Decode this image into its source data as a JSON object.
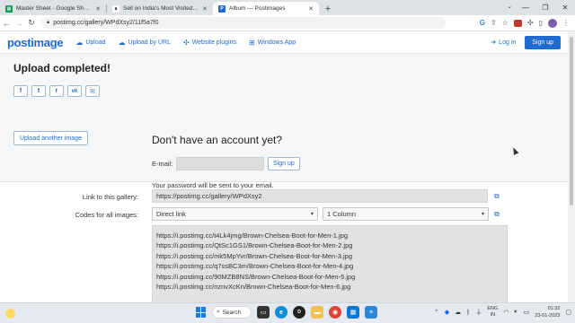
{
  "browser": {
    "tabs": [
      {
        "title": "Master Sheet - Google Sheets",
        "favicon_color": "#0f9d58",
        "favicon_glyph": "▦"
      },
      {
        "title": "Sell on India's Most Visited Shopp",
        "favicon_color": "#111111",
        "favicon_glyph": "a"
      },
      {
        "title": "Album — Postimages",
        "favicon_color": "#1d6bd1",
        "favicon_glyph": "P"
      }
    ],
    "active_tab": 2,
    "url": "postimg.cc/gallery/WPdXsy2/11f5a7f0"
  },
  "site": {
    "logo": "postimage",
    "nav": [
      {
        "label": "Upload",
        "icon": "cloud-upload-icon",
        "glyph": "☁"
      },
      {
        "label": "Upload by URL",
        "icon": "cloud-link-icon",
        "glyph": "☁"
      },
      {
        "label": "Website plugins",
        "icon": "puzzle-icon",
        "glyph": "✣"
      },
      {
        "label": "Windows App",
        "icon": "windows-icon",
        "glyph": "⊞"
      }
    ],
    "login_label": "Log in",
    "signup_label": "Sign up"
  },
  "upload": {
    "title": "Upload completed!",
    "share_buttons": [
      {
        "icon": "facebook-icon",
        "glyph": "f"
      },
      {
        "icon": "twitter-icon",
        "glyph": "t"
      },
      {
        "icon": "reddit-icon",
        "glyph": "r"
      },
      {
        "icon": "vk-icon",
        "glyph": "vk"
      },
      {
        "icon": "mail-icon",
        "glyph": "✉"
      }
    ],
    "upload_another_label": "Upload another image"
  },
  "account": {
    "title": "Don't have an account yet?",
    "email_label": "E-mail:",
    "email_value": "",
    "signup_label": "Sign up",
    "password_note": "Your password will be sent to your email."
  },
  "links": {
    "gallery_label": "Link to this gallery:",
    "gallery_url": "https://postimg.cc/gallery/WPdXsy2",
    "codes_label": "Codes for all images:",
    "link_type": "Direct link",
    "columns": "1 Column",
    "codes": [
      "https://i.postimg.cc/t4Lk4jmg/Brown-Chelsea-Boot-for-Men-1.jpg",
      "https://i.postimg.cc/QtSc1GS1/Brown-Chelsea-Boot-for-Men-2.jpg",
      "https://i.postimg.cc/mk5MpYvr/Brown-Chelsea-Boot-for-Men-3.jpg",
      "https://i.postimg.cc/q7ssBC3m/Brown-Chelsea-Boot-for-Men-4.jpg",
      "https://i.postimg.cc/90MZB8NS/Brown-Chelsea-Boot-for-Men-5.jpg",
      "https://i.postimg.cc/nznvXcKn/Brown-Chelsea-Boot-for-Men-6.jpg"
    ]
  },
  "taskbar": {
    "search_label": "Search",
    "lang_line1": "ENG",
    "lang_line2": "IN",
    "time": "01:32",
    "date": "23-01-2023"
  }
}
